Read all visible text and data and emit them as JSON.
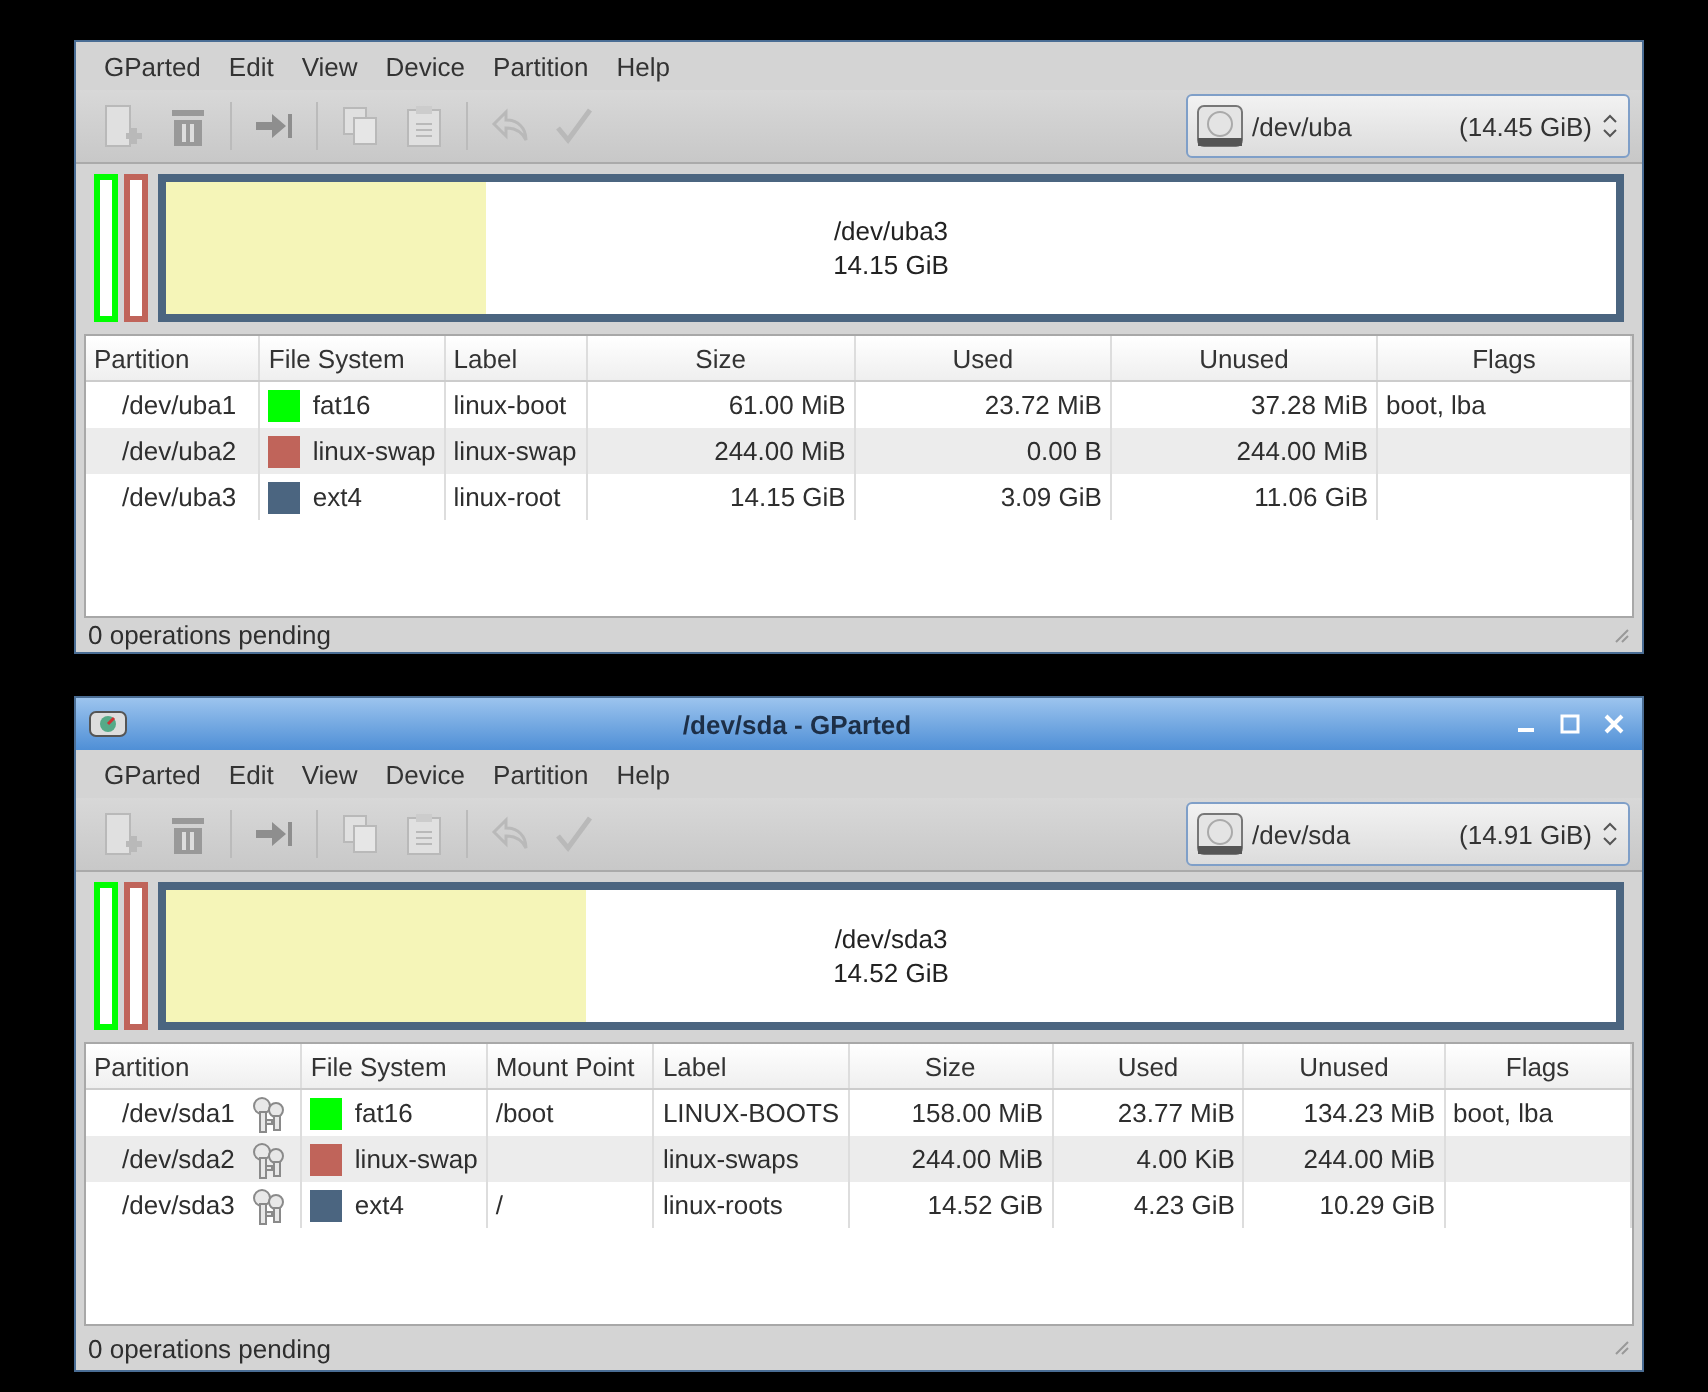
{
  "windows": [
    {
      "menu": [
        "GParted",
        "Edit",
        "View",
        "Device",
        "Partition",
        "Help"
      ],
      "device": {
        "name": "/dev/uba",
        "size": "(14.45 GiB)"
      },
      "map": [
        {
          "color": "#00ff00"
        },
        {
          "color": "#c0645a"
        },
        {
          "color": "#4b6580",
          "name": "/dev/uba3",
          "size": "14.15 GiB",
          "level": 0.22
        }
      ],
      "columns": [
        {
          "label": "Partition",
          "kind": "partition"
        },
        {
          "label": "File System",
          "kind": "fs"
        },
        {
          "label": "Label",
          "kind": "text"
        },
        {
          "label": "Size",
          "kind": "number"
        },
        {
          "label": "Used",
          "kind": "number"
        },
        {
          "label": "Unused",
          "kind": "number"
        },
        {
          "label": "Flags",
          "kind": "flags"
        }
      ],
      "rows": [
        {
          "cells": [
            "/dev/uba1",
            "fat16",
            "linux-boot",
            "61.00 MiB",
            "23.72 MiB",
            "37.28 MiB",
            "boot, lba"
          ],
          "color": "#00ff00"
        },
        {
          "cells": [
            "/dev/uba2",
            "linux-swap",
            "linux-swap",
            "244.00 MiB",
            "0.00 B",
            "244.00 MiB",
            null
          ],
          "color": "#c0645a"
        },
        {
          "cells": [
            "/dev/uba3",
            "ext4",
            "linux-root",
            "14.15 GiB",
            "3.09 GiB",
            "11.06 GiB",
            null
          ],
          "color": "#4b6580"
        }
      ],
      "status": "0 operations pending"
    },
    {
      "title": "/dev/sda - GParted",
      "menu": [
        "GParted",
        "Edit",
        "View",
        "Device",
        "Partition",
        "Help"
      ],
      "device": {
        "name": "/dev/sda",
        "size": "(14.91 GiB)"
      },
      "map": [
        {
          "color": "#00ff00"
        },
        {
          "color": "#c0645a"
        },
        {
          "color": "#4b6580",
          "name": "/dev/sda3",
          "size": "14.52 GiB",
          "level": 0.29
        }
      ],
      "columns": [
        {
          "label": "Partition",
          "kind": "partition"
        },
        {
          "label": "File System",
          "kind": "fs"
        },
        {
          "label": "Mount Point",
          "kind": "text"
        },
        {
          "label": "Label",
          "kind": "text"
        },
        {
          "label": "Size",
          "kind": "number"
        },
        {
          "label": "Used",
          "kind": "number"
        },
        {
          "label": "Unused",
          "kind": "number"
        },
        {
          "label": "Flags",
          "kind": "flags"
        }
      ],
      "rows": [
        {
          "cells": [
            "/dev/sda1",
            "fat16",
            "/boot",
            "LINUX-BOOTS",
            "158.00 MiB",
            "23.77 MiB",
            "134.23 MiB",
            "boot, lba"
          ],
          "color": "#00ff00",
          "mounted": true
        },
        {
          "cells": [
            "/dev/sda2",
            "linux-swap",
            null,
            "linux-swaps",
            "244.00 MiB",
            "4.00 KiB",
            "244.00 MiB",
            null
          ],
          "color": "#c0645a",
          "mounted": true
        },
        {
          "cells": [
            "/dev/sda3",
            "ext4",
            "/",
            "linux-roots",
            "14.52 GiB",
            "4.23 GiB",
            "10.29 GiB",
            null
          ],
          "color": "#4b6580",
          "mounted": true
        }
      ],
      "status": "0 operations pending"
    }
  ]
}
